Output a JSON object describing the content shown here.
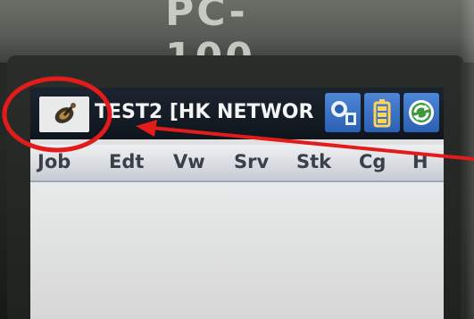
{
  "device": {
    "model_label": "PC-100"
  },
  "title_bar": {
    "app_icon": "satellite-antenna-icon",
    "title": "TEST2 [HK NETWOR",
    "status_icons": [
      "gps-rover-icon",
      "battery-icon",
      "sync-icon"
    ]
  },
  "menu": {
    "items": [
      "Job",
      "Edt",
      "Vw",
      "Srv",
      "Stk",
      "Cg",
      "H"
    ]
  },
  "annotation": {
    "highlight_color": "#e41b1b",
    "target": "app-icon"
  },
  "colors": {
    "title_bar": "#0f151c",
    "status_button": "#2b5fb1",
    "screen_background": "#dfe0df"
  }
}
